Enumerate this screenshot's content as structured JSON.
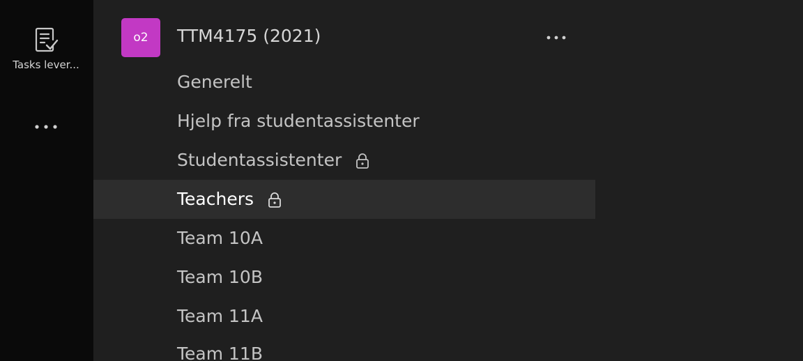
{
  "rail": {
    "tasks_label": "Tasks lever...",
    "tasks_icon": "tasks-icon",
    "more_icon": "more-horizontal-icon"
  },
  "team": {
    "avatar_text": "o2",
    "avatar_color": "#c239c4",
    "name": "TTM4175 (2021)",
    "more_icon": "more-horizontal-icon"
  },
  "channels": [
    {
      "label": "Generelt",
      "locked": false,
      "selected": false
    },
    {
      "label": "Hjelp fra studentassistenter",
      "locked": false,
      "selected": false
    },
    {
      "label": "Studentassistenter",
      "locked": true,
      "selected": false
    },
    {
      "label": "Teachers",
      "locked": true,
      "selected": true
    },
    {
      "label": "Team 10A",
      "locked": false,
      "selected": false
    },
    {
      "label": "Team 10B",
      "locked": false,
      "selected": false
    },
    {
      "label": "Team 11A",
      "locked": false,
      "selected": false
    },
    {
      "label": "Team 11B",
      "locked": false,
      "selected": false
    }
  ],
  "colors": {
    "rail_bg": "#0a0a0a",
    "pane_bg": "#1f1f1f",
    "selected_bg": "#2d2d2d",
    "text": "#c4c4c4",
    "text_selected": "#ffffff"
  }
}
